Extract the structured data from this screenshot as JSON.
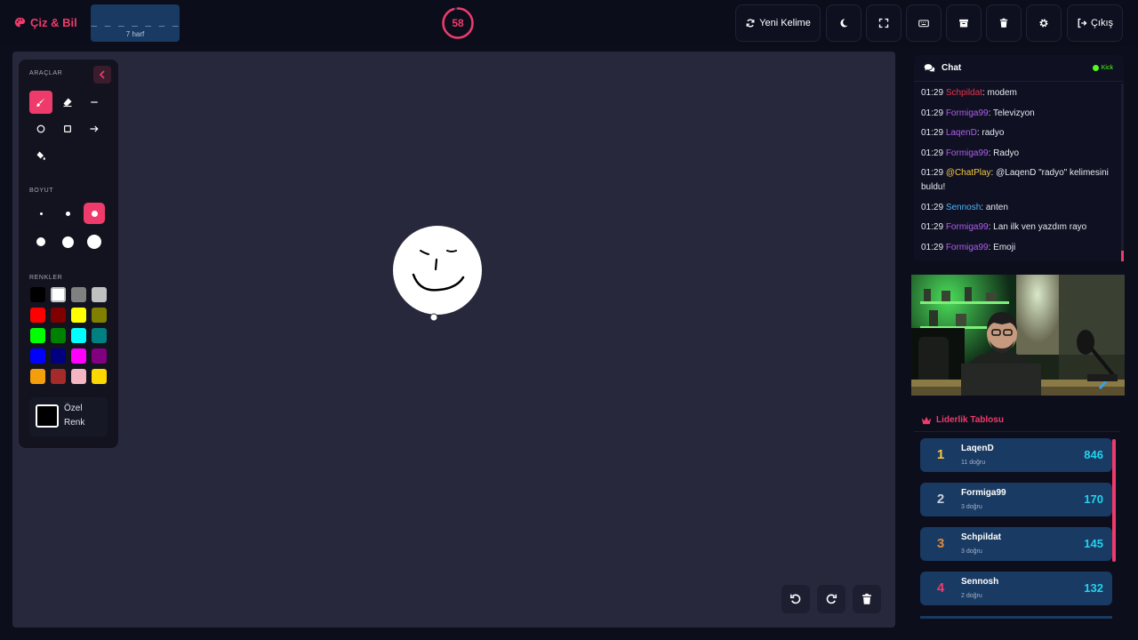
{
  "app": {
    "name": "Çiz & Bil"
  },
  "word": {
    "mask": "_ _ _ _ _ _ _",
    "hint": "7 harf"
  },
  "timer": {
    "seconds": "58",
    "remaining_fraction": 0.95
  },
  "toolbar": {
    "new_word": "Yeni Kelime",
    "logout": "Çıkış",
    "icons": [
      "moon-icon",
      "fullscreen-icon",
      "keyboard-icon",
      "archive-icon",
      "trash-icon",
      "gear-icon"
    ]
  },
  "tools_panel": {
    "tools_title": "ARAÇLAR",
    "size_title": "BOYUT",
    "colors_title": "RENKLER",
    "tools": [
      "brush",
      "eraser",
      "line",
      "circle",
      "rectangle",
      "arrow",
      "fill"
    ],
    "active_tool": "brush",
    "active_size_index": 2,
    "colors": [
      "#000000",
      "#ffffff",
      "#808080",
      "#c0c0c0",
      "#ff0000",
      "#800000",
      "#ffff00",
      "#808000",
      "#00ff00",
      "#008000",
      "#00ffff",
      "#008080",
      "#0000ff",
      "#000080",
      "#ff00ff",
      "#800080",
      "#f59e0b",
      "#a52a2a",
      "#f4b6c2",
      "#ffd700"
    ],
    "custom_color_label": "Özel Renk"
  },
  "chat": {
    "title": "Chat",
    "platform": "Kick",
    "messages": [
      {
        "time": "01:29",
        "user": "Schpildat",
        "color": "#e8334a",
        "text": ": modem"
      },
      {
        "time": "01:29",
        "user": "Formiga99",
        "color": "#b05cf0",
        "text": ": Televizyon"
      },
      {
        "time": "01:29",
        "user": "LaqenD",
        "color": "#b05cf0",
        "text": ": radyo"
      },
      {
        "time": "01:29",
        "user": "Formiga99",
        "color": "#b05cf0",
        "text": ": Radyo"
      },
      {
        "time": "01:29",
        "user": "@ChatPlay",
        "color": "#f5c842",
        "text": ": @LaqenD \"radyo\" kelimesini buldu!"
      },
      {
        "time": "01:29",
        "user": "Sennosh",
        "color": "#4fb3f7",
        "text": ": anten"
      },
      {
        "time": "01:29",
        "user": "Formiga99",
        "color": "#b05cf0",
        "text": ": Lan ilk ven yazdım rayo"
      },
      {
        "time": "01:29",
        "user": "Formiga99",
        "color": "#b05cf0",
        "text": ": Emoji"
      }
    ]
  },
  "leaderboard": {
    "title": "Liderlik Tablosu",
    "entries": [
      {
        "rank": "1",
        "name": "LaqenD",
        "sub": "11 doğru",
        "score": "846",
        "rank_color": "#f5c842"
      },
      {
        "rank": "2",
        "name": "Formiga99",
        "sub": "3 doğru",
        "score": "170",
        "rank_color": "#c7cfdb"
      },
      {
        "rank": "3",
        "name": "Schpildat",
        "sub": "3 doğru",
        "score": "145",
        "rank_color": "#e0883a"
      },
      {
        "rank": "4",
        "name": "Sennosh",
        "sub": "2 doğru",
        "score": "132",
        "rank_color": "#ef3b6b"
      }
    ]
  },
  "colors": {
    "accent": "#ef3b6b",
    "panel_blue": "#193a63",
    "score": "#22d3ee"
  }
}
